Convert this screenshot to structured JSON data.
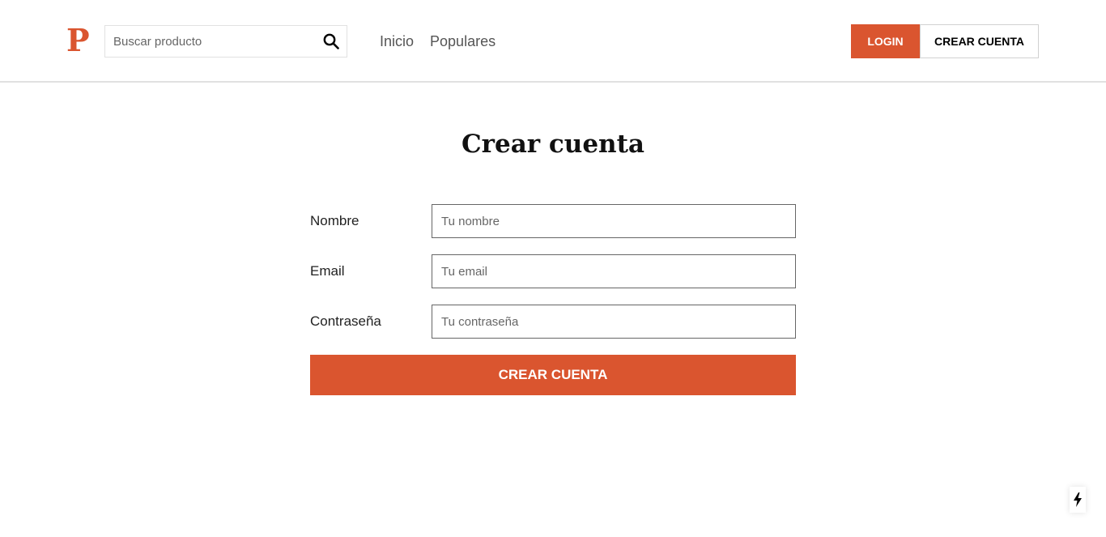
{
  "header": {
    "logo_letter": "P",
    "search": {
      "placeholder": "Buscar producto",
      "value": "",
      "icon": "search-icon"
    },
    "nav": [
      {
        "label": "Inicio"
      },
      {
        "label": "Populares"
      }
    ],
    "login_label": "LOGIN",
    "signup_label": "CREAR CUENTA"
  },
  "form": {
    "title": "Crear cuenta",
    "fields": [
      {
        "label": "Nombre",
        "placeholder": "Tu nombre",
        "value": ""
      },
      {
        "label": "Email",
        "placeholder": "Tu email",
        "value": ""
      },
      {
        "label": "Contraseña",
        "placeholder": "Tu contraseña",
        "value": ""
      }
    ],
    "submit_label": "CREAR CUENTA"
  },
  "dev_indicator": {
    "icon": "lightning-icon"
  },
  "colors": {
    "accent": "#da552f",
    "border": "#e1e1e1",
    "text": "#222222"
  }
}
